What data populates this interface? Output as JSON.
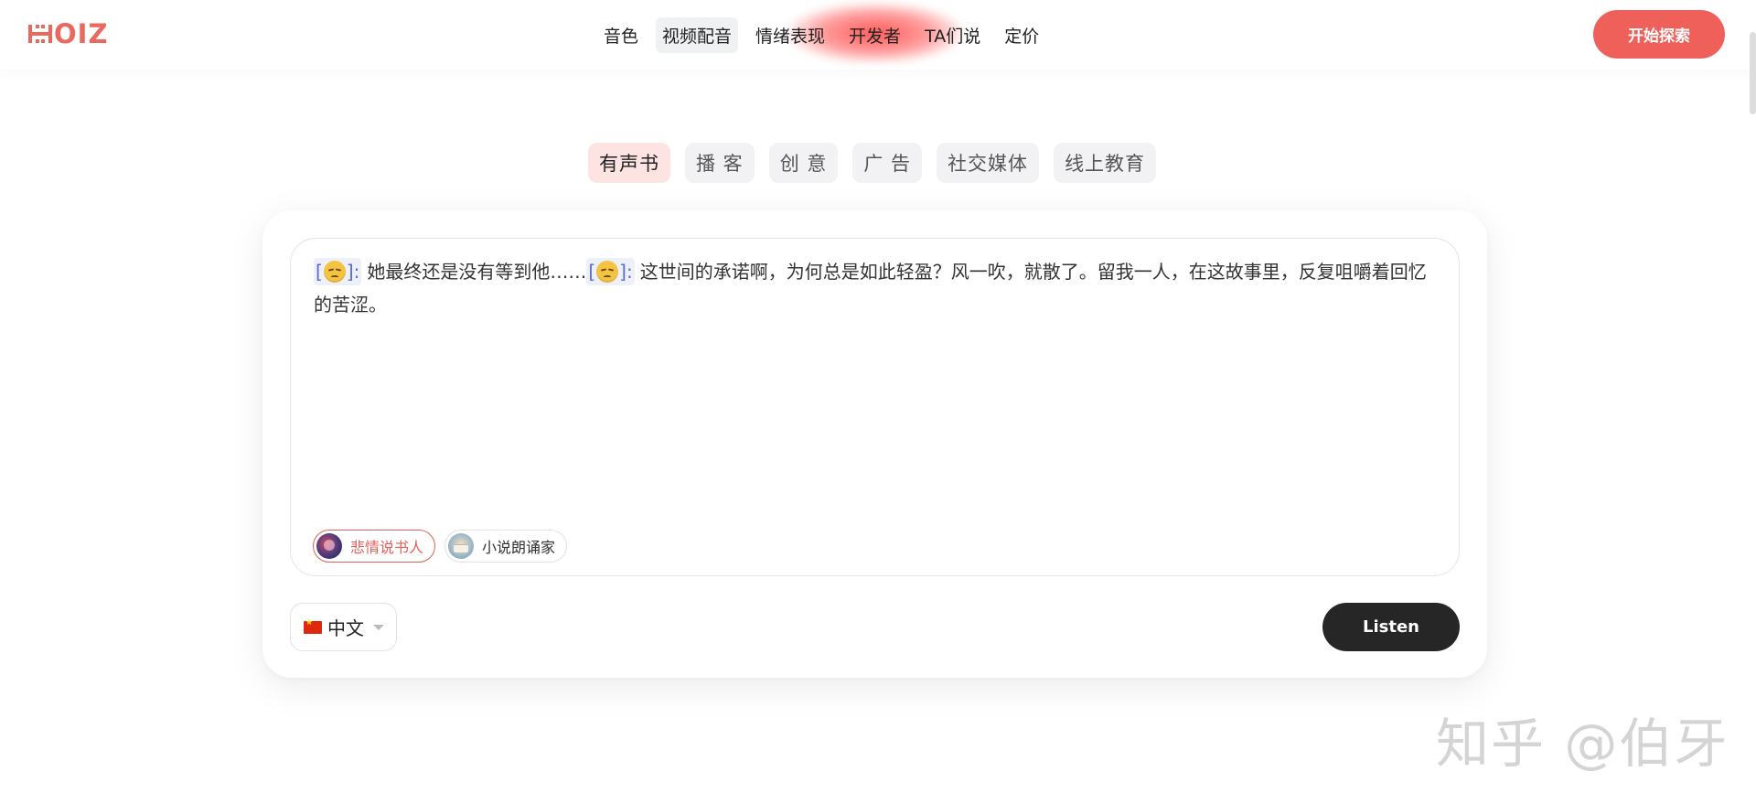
{
  "header": {
    "logo_text": "OIZ",
    "nav": [
      {
        "label": "音色"
      },
      {
        "label": "视频配音"
      },
      {
        "label": "情绪表现"
      },
      {
        "label": "开发者"
      },
      {
        "label": "TA们说"
      },
      {
        "label": "定价"
      }
    ],
    "active_nav": "视频配音",
    "cta_label": "开始探索"
  },
  "categories": [
    {
      "label": "有声书"
    },
    {
      "label": "播 客"
    },
    {
      "label": "创 意"
    },
    {
      "label": "广 告"
    },
    {
      "label": "社交媒体"
    },
    {
      "label": "线上教育"
    }
  ],
  "selected_category": "有声书",
  "editor": {
    "tag_1_open": "[",
    "tag_1_close": "]:",
    "segment_1": "她最终还是没有等到他……",
    "tag_2_open": "[",
    "tag_2_close": "]:",
    "segment_2": "这世间的承诺啊，为何总是如此轻盈？风一吹，就散了。留我一人，在这故事里，反复咀嚼着回忆的苦涩。",
    "emotion_icon": "sad-face-emoji"
  },
  "voices": [
    {
      "label": "悲情说书人",
      "selected": true,
      "avatar": "storyteller-avatar"
    },
    {
      "label": "小说朗诵家",
      "selected": false,
      "avatar": "reader-avatar"
    }
  ],
  "language": {
    "value": "中文",
    "flag": "china-flag"
  },
  "listen_label": "Listen",
  "watermark": "知乎 @伯牙",
  "colors": {
    "brand": "#f0605a",
    "listen_button": "#262626",
    "tag_text": "#5b6bd6",
    "selected_category_bg": "#fde3e1"
  }
}
